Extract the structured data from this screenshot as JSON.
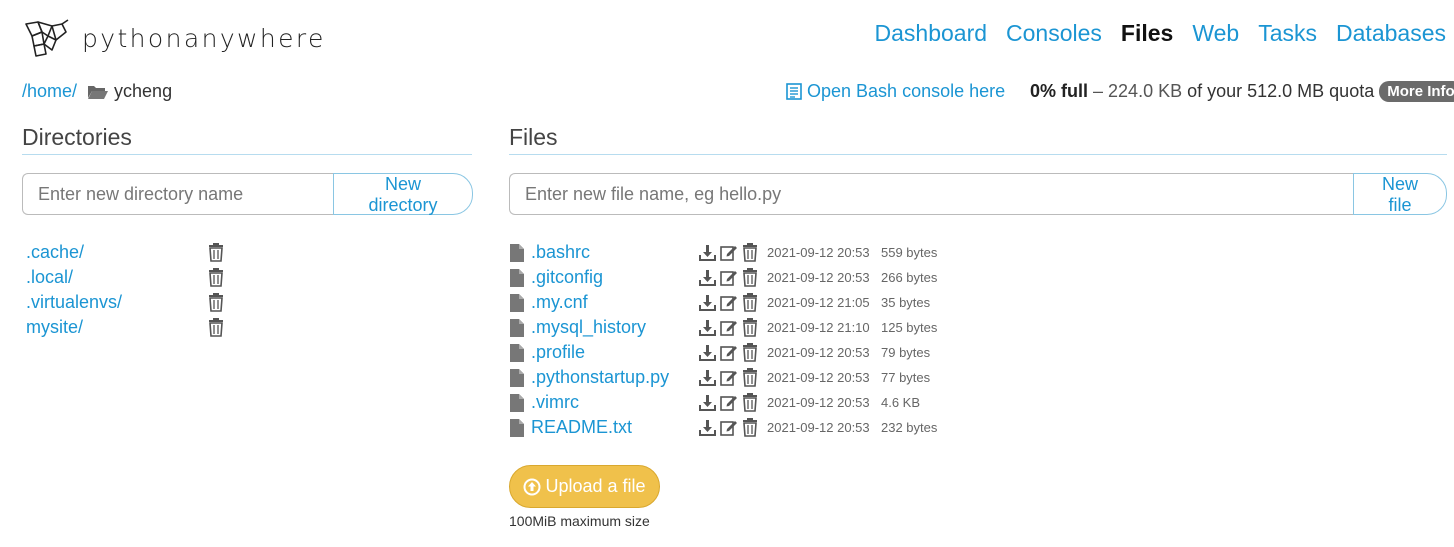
{
  "header": {
    "logo_text": "pythonanywhere",
    "nav": [
      {
        "label": "Dashboard",
        "active": false
      },
      {
        "label": "Consoles",
        "active": false
      },
      {
        "label": "Files",
        "active": true
      },
      {
        "label": "Web",
        "active": false
      },
      {
        "label": "Tasks",
        "active": false
      },
      {
        "label": "Databases",
        "active": false
      }
    ]
  },
  "breadcrumb": {
    "home": "/home/",
    "current": "ycheng"
  },
  "bash_link": "Open Bash console here",
  "quota": {
    "percent": "0% full",
    "dash": "–",
    "used": "224.0 KB",
    "of": "of your 512.0 MB quota",
    "more_info": "More Info"
  },
  "directories": {
    "heading": "Directories",
    "input_placeholder": "Enter new directory name",
    "button": "New directory",
    "items": [
      ".cache/",
      ".local/",
      ".virtualenvs/",
      "mysite/"
    ]
  },
  "files": {
    "heading": "Files",
    "input_placeholder": "Enter new file name, eg hello.py",
    "button": "New file",
    "items": [
      {
        "name": ".bashrc",
        "date": "2021-09-12 20:53",
        "size": "559 bytes"
      },
      {
        "name": ".gitconfig",
        "date": "2021-09-12 20:53",
        "size": "266 bytes"
      },
      {
        "name": ".my.cnf",
        "date": "2021-09-12 21:05",
        "size": "35 bytes"
      },
      {
        "name": ".mysql_history",
        "date": "2021-09-12 21:10",
        "size": "125 bytes"
      },
      {
        "name": ".profile",
        "date": "2021-09-12 20:53",
        "size": "79 bytes"
      },
      {
        "name": ".pythonstartup.py",
        "date": "2021-09-12 20:53",
        "size": "77 bytes"
      },
      {
        "name": ".vimrc",
        "date": "2021-09-12 20:53",
        "size": "4.6 KB"
      },
      {
        "name": "README.txt",
        "date": "2021-09-12 20:53",
        "size": "232 bytes"
      }
    ]
  },
  "upload": {
    "button": "Upload a file",
    "note": "100MiB maximum size"
  },
  "colors": {
    "link": "#1b95d3",
    "upload": "#f0c14b",
    "badge": "#6b6b6b"
  }
}
